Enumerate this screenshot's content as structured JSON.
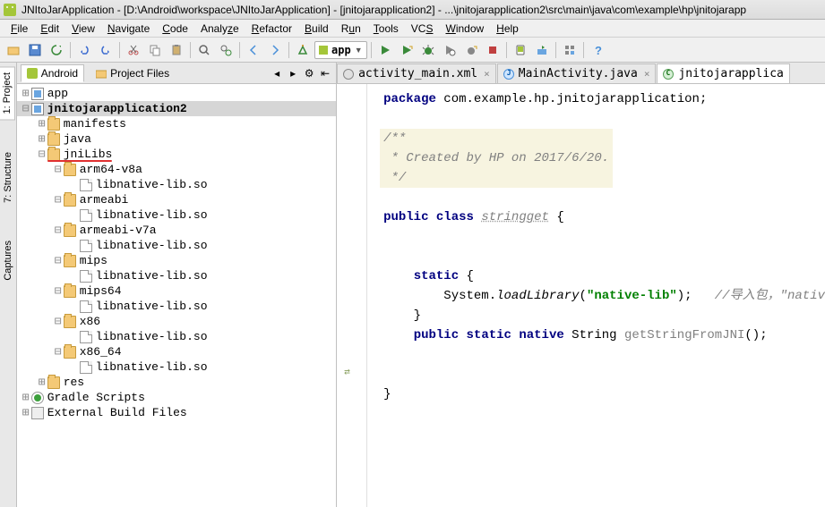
{
  "window": {
    "title": "JNItoJarApplication - [D:\\Android\\workspace\\JNItoJarApplication] - [jnitojarapplication2] - ...\\jnitojarapplication2\\src\\main\\java\\com\\example\\hp\\jnitojarapp"
  },
  "menu": [
    "File",
    "Edit",
    "View",
    "Navigate",
    "Code",
    "Analyze",
    "Refactor",
    "Build",
    "Run",
    "Tools",
    "VCS",
    "Window",
    "Help"
  ],
  "toolbar": {
    "run_config": "app"
  },
  "sidebar_tabs": [
    "1: Project",
    "7: Structure",
    "Captures"
  ],
  "panel": {
    "tabs": [
      "Android",
      "Project Files"
    ],
    "active_tab_idx": 0
  },
  "tree": [
    {
      "d": 0,
      "t": "+",
      "icon": "module",
      "label": "app"
    },
    {
      "d": 0,
      "t": "-",
      "icon": "module",
      "label": "jnitojarapplication2",
      "sel": true,
      "bold": true
    },
    {
      "d": 1,
      "t": "+",
      "icon": "folder",
      "label": "manifests"
    },
    {
      "d": 1,
      "t": "+",
      "icon": "folder",
      "label": "java"
    },
    {
      "d": 1,
      "t": "-",
      "icon": "folder",
      "label": "jniLibs",
      "red": true
    },
    {
      "d": 2,
      "t": "-",
      "icon": "folder",
      "label": "arm64-v8a"
    },
    {
      "d": 3,
      "t": "",
      "icon": "file",
      "label": "libnative-lib.so"
    },
    {
      "d": 2,
      "t": "-",
      "icon": "folder",
      "label": "armeabi"
    },
    {
      "d": 3,
      "t": "",
      "icon": "file",
      "label": "libnative-lib.so"
    },
    {
      "d": 2,
      "t": "-",
      "icon": "folder",
      "label": "armeabi-v7a"
    },
    {
      "d": 3,
      "t": "",
      "icon": "file",
      "label": "libnative-lib.so"
    },
    {
      "d": 2,
      "t": "-",
      "icon": "folder",
      "label": "mips"
    },
    {
      "d": 3,
      "t": "",
      "icon": "file",
      "label": "libnative-lib.so"
    },
    {
      "d": 2,
      "t": "-",
      "icon": "folder",
      "label": "mips64"
    },
    {
      "d": 3,
      "t": "",
      "icon": "file",
      "label": "libnative-lib.so"
    },
    {
      "d": 2,
      "t": "-",
      "icon": "folder",
      "label": "x86"
    },
    {
      "d": 3,
      "t": "",
      "icon": "file",
      "label": "libnative-lib.so"
    },
    {
      "d": 2,
      "t": "-",
      "icon": "folder",
      "label": "x86_64"
    },
    {
      "d": 3,
      "t": "",
      "icon": "file",
      "label": "libnative-lib.so"
    },
    {
      "d": 1,
      "t": "+",
      "icon": "folder",
      "label": "res"
    },
    {
      "d": 0,
      "t": "+",
      "icon": "gradle",
      "label": "Gradle Scripts"
    },
    {
      "d": 0,
      "t": "+",
      "icon": "ext",
      "label": "External Build Files"
    }
  ],
  "editor_tabs": [
    {
      "icon": "xml",
      "label": "activity_main.xml",
      "close": true
    },
    {
      "icon": "java",
      "label": "MainActivity.java",
      "close": true
    },
    {
      "icon": "class",
      "label": "jnitojarapplica",
      "close": false,
      "active": true
    }
  ],
  "code": {
    "package_kw": "package",
    "package_name": " com.example.hp.jnitojarapplication;",
    "doc_open": "/**",
    "doc_body": " * Created by HP on 2017/6/20.",
    "doc_close": " */",
    "public": "public",
    "class": "class",
    "classname": "stringget",
    "brace_open": " {",
    "static": "static",
    "brace_open2": " {",
    "sys_load": "        System.",
    "loadlib": "loadLibrary",
    "paren": "(",
    "lib": "\"native-lib\"",
    "paren2": ");",
    "cmt1": "   //导入包，\"nativ",
    "brace_close": "    }",
    "native_line_pre": "    ",
    "native": "native",
    "string": " String ",
    "method": "getStringFromJNI",
    "end": "();",
    "brace_close2": "}"
  }
}
